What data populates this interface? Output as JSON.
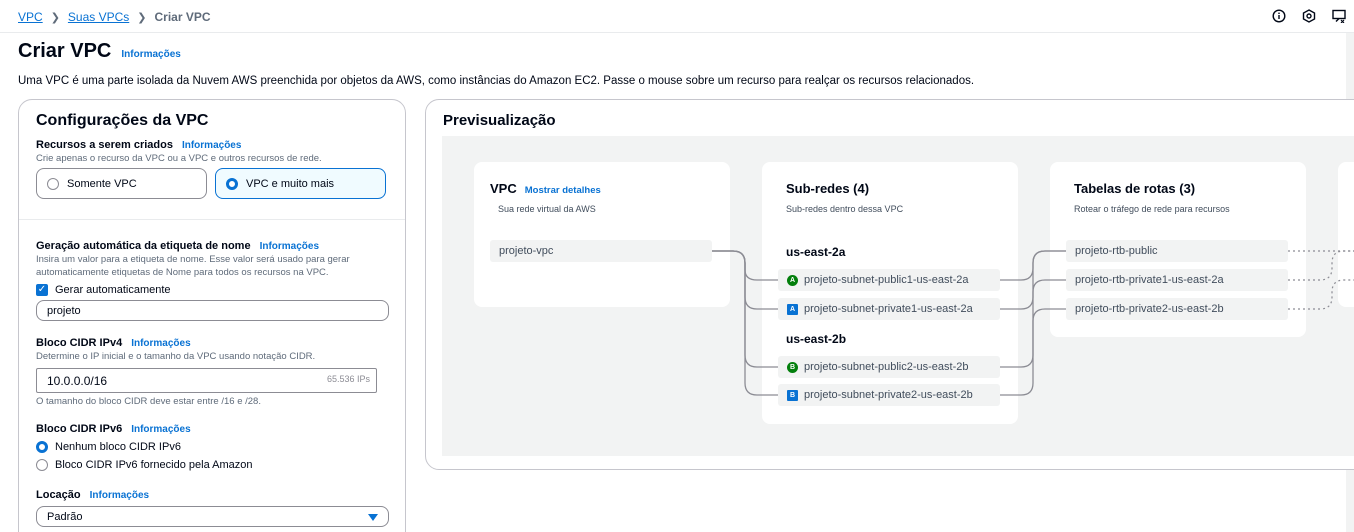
{
  "breadcrumb": {
    "root": "VPC",
    "parent": "Suas VPCs",
    "current": "Criar VPC"
  },
  "toolbar": {
    "icons": [
      "info-icon",
      "settings-icon",
      "feedback-icon"
    ]
  },
  "header": {
    "title": "Criar VPC",
    "info": "Informações",
    "description": "Uma VPC é uma parte isolada da Nuvem AWS preenchida por objetos da AWS, como instâncias do Amazon EC2. Passe o mouse sobre um recurso para realçar os recursos relacionados."
  },
  "config": {
    "title": "Configurações da VPC",
    "resources": {
      "label": "Recursos a serem criados",
      "info": "Informações",
      "hint": "Crie apenas o recurso da VPC ou a VPC e outros recursos de rede.",
      "options": [
        "Somente VPC",
        "VPC e muito mais"
      ],
      "selected": "VPC e muito mais"
    },
    "name_tag": {
      "label": "Geração automática da etiqueta de nome",
      "info": "Informações",
      "hint": "Insira um valor para a etiqueta de nome. Esse valor será usado para gerar automaticamente etiquetas de Nome para todos os recursos na VPC.",
      "checkbox_label": "Gerar automaticamente",
      "value": "projeto"
    },
    "ipv4": {
      "label": "Bloco CIDR IPv4",
      "info": "Informações",
      "hint": "Determine o IP inicial e o tamanho da VPC usando notação CIDR.",
      "value": "10.0.0.0/16",
      "count": "65.536 IPs",
      "constraint": "O tamanho do bloco CIDR deve estar entre /16 e /28."
    },
    "ipv6": {
      "label": "Bloco CIDR IPv6",
      "info": "Informações",
      "options": [
        "Nenhum bloco CIDR IPv6",
        "Bloco CIDR IPv6 fornecido pela Amazon"
      ],
      "selected": "Nenhum bloco CIDR IPv6"
    },
    "tenancy": {
      "label": "Locação",
      "info": "Informações",
      "value": "Padrão"
    }
  },
  "preview": {
    "title": "Previsualização",
    "vpc": {
      "title": "VPC",
      "link": "Mostrar detalhes",
      "subtitle": "Sua rede virtual da AWS",
      "name": "projeto-vpc"
    },
    "subnets": {
      "title": "Sub-redes (4)",
      "subtitle": "Sub-redes dentro dessa VPC",
      "zones": [
        {
          "name": "us-east-2a",
          "items": [
            {
              "badge": "A",
              "kind": "public",
              "name": "projeto-subnet-public1-us-east-2a"
            },
            {
              "badge": "A",
              "kind": "private",
              "name": "projeto-subnet-private1-us-east-2a"
            }
          ]
        },
        {
          "name": "us-east-2b",
          "items": [
            {
              "badge": "B",
              "kind": "public",
              "name": "projeto-subnet-public2-us-east-2b"
            },
            {
              "badge": "B",
              "kind": "private",
              "name": "projeto-subnet-private2-us-east-2b"
            }
          ]
        }
      ]
    },
    "route_tables": {
      "title": "Tabelas de rotas (3)",
      "subtitle": "Rotear o tráfego de rede para recursos",
      "items": [
        "projeto-rtb-public",
        "projeto-rtb-private1-us-east-2a",
        "projeto-rtb-private2-us-east-2b"
      ]
    }
  }
}
